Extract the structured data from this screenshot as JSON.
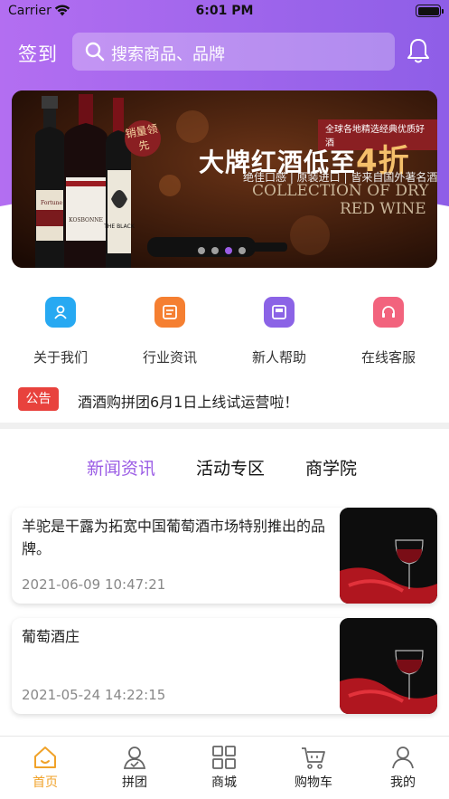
{
  "status_bar": {
    "carrier": "Carrier",
    "time": "6:01 PM"
  },
  "header": {
    "checkin_label": "签到",
    "search_placeholder": "搜索商品、品牌"
  },
  "banner": {
    "badge_text": "全球各地精选经典优质好酒",
    "title_prefix": "大牌红酒低至",
    "title_accent": "4折",
    "slogan": "绝佳口感 | 原装进口 | 皆来自国外著名酒庄！",
    "english_line1": "COLLECTION OF DRY",
    "english_line2": "RED WINE",
    "tag": "销量领先",
    "bottle_labels": [
      "Fortune Kangaroo",
      "KOSBONNE",
      "THE BLACK CHOOK"
    ],
    "slides": 4,
    "active_slide": 3
  },
  "quick_menu": [
    {
      "label": "关于我们",
      "icon": "user-icon",
      "color": "#27a9f2"
    },
    {
      "label": "行业资讯",
      "icon": "document-icon",
      "color": "#f57f31"
    },
    {
      "label": "新人帮助",
      "icon": "book-icon",
      "color": "#8b63e6"
    },
    {
      "label": "在线客服",
      "icon": "headset-icon",
      "color": "#f2637d"
    }
  ],
  "notice": {
    "badge": "公告",
    "text": "酒酒购拼团6月1日上线试运营啦！"
  },
  "tabs": [
    {
      "label": "新闻资讯",
      "active": true
    },
    {
      "label": "活动专区",
      "active": false
    },
    {
      "label": "商学院",
      "active": false
    }
  ],
  "news": [
    {
      "title": "羊驼是干露为拓宽中国葡萄酒市场特别推出的品牌。",
      "date": "2021-06-09 10:47:21"
    },
    {
      "title": "葡萄酒庄",
      "date": "2021-05-24 14:22:15"
    }
  ],
  "tab_bar": [
    {
      "label": "首页",
      "icon": "home-icon",
      "active": true
    },
    {
      "label": "拼团",
      "icon": "group-icon",
      "active": false
    },
    {
      "label": "商城",
      "icon": "grid-icon",
      "active": false
    },
    {
      "label": "购物车",
      "icon": "cart-icon",
      "active": false
    },
    {
      "label": "我的",
      "icon": "profile-icon",
      "active": false
    }
  ],
  "colors": {
    "brand_purple": "#9b5de5",
    "header_gradient_start": "#b26cf0",
    "header_gradient_end": "#8f5ee8",
    "notice_red": "#e8423d",
    "tabbar_active": "#f0a229"
  }
}
